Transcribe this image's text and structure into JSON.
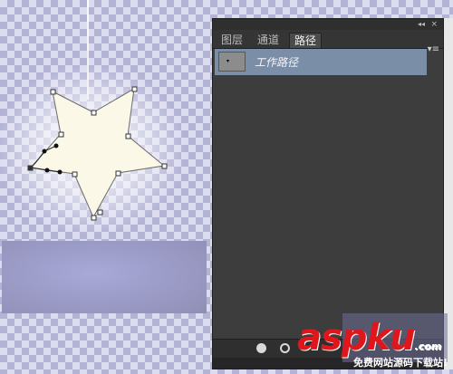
{
  "panel": {
    "tabs": [
      {
        "label": "图层",
        "active": false
      },
      {
        "label": "通道",
        "active": false
      },
      {
        "label": "路径",
        "active": true
      }
    ],
    "collapse_glyph": "◂◂",
    "close_glyph": "×",
    "menu_glyph": "▾≡",
    "paths": [
      {
        "name": "工作路径",
        "selected": true
      }
    ],
    "bottom_buttons": [
      "fill-path-with-foreground-icon",
      "stroke-path-with-brush-icon"
    ]
  },
  "watermark": {
    "logo": "aspku",
    "logo_suffix": ".com",
    "subtitle": "免费网站源码下载站!"
  },
  "colors": {
    "selected_row": "#7b8ea8",
    "panel_bg": "#3d3d3d",
    "watermark_red": "#e0161d"
  }
}
